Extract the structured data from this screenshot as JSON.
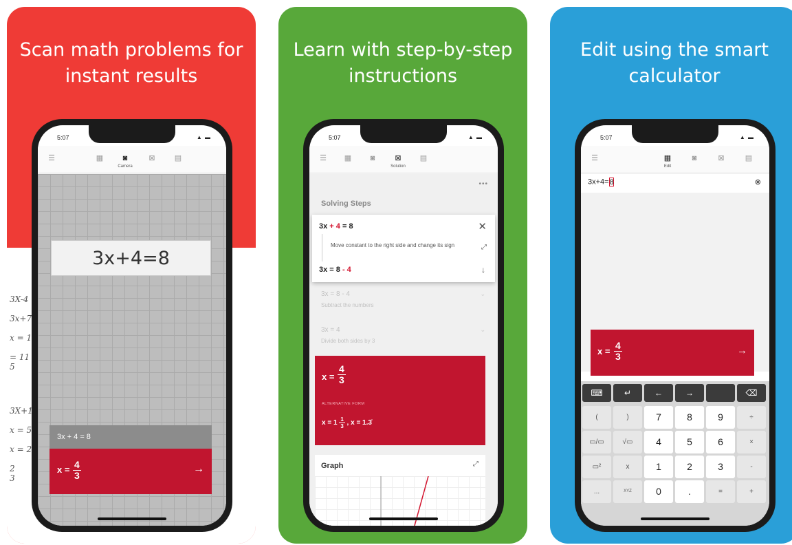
{
  "screens": [
    {
      "title": "Scan math problems for instant results",
      "time": "5:07",
      "status_icons": "▲ ▬",
      "toolbar": [
        "menu-icon",
        "calculator-icon",
        "camera-icon",
        "solution-icon",
        "notes-icon"
      ],
      "active_label": "Camera",
      "scanned_equation": "3x+4=8",
      "equation_bar": "3x + 4 = 8",
      "result": {
        "lhs": "x =",
        "num": "4",
        "den": "3"
      },
      "background_math": [
        "3X-4",
        "3x+7",
        "x = 11",
        "= 11",
        "5",
        "3X+1",
        "x = 5",
        "x = 2",
        "2",
        "3"
      ]
    },
    {
      "title": "Learn with step-by-step instructions",
      "time": "5:07",
      "status_icons": "▲ ▬",
      "active_label": "Solution",
      "more": "•••",
      "steps_heading": "Solving Steps",
      "active_step": {
        "eq_pre": "3x ",
        "eq_red": "+ 4",
        "eq_post": " = 8",
        "description": "Move constant to the right side and change its sign",
        "result_pre": "3x = 8 ",
        "result_red": "- 4"
      },
      "faded_steps": [
        {
          "eq": "3x = 8 - 4",
          "desc": "Subtract the numbers"
        },
        {
          "eq": "3x = 4",
          "desc": "Divide both sides by 3"
        }
      ],
      "result": {
        "lhs": "x =",
        "num": "4",
        "den": "3"
      },
      "alt_label": "ALTERNATIVE FORM",
      "alt_whole": "x = 1",
      "alt_num": "1",
      "alt_den": "3",
      "alt_decimal": ", x = 1.3̇",
      "graph_title": "Graph"
    },
    {
      "title": "Edit using the smart calculator",
      "time": "5:07",
      "status_icons": "▲ ▬",
      "active_label": "Edit",
      "input": "3x+4=",
      "input_cursor": "8",
      "clear": "⊗",
      "result": {
        "lhs": "x =",
        "num": "4",
        "den": "3"
      },
      "keyboard_top": [
        "⌨",
        "↵",
        "←",
        "→",
        "",
        "⌫"
      ],
      "keyboard_rows": [
        [
          "(",
          ")",
          "7",
          "8",
          "9",
          "÷"
        ],
        [
          "▭/▭",
          "√▭",
          "4",
          "5",
          "6",
          "×"
        ],
        [
          "▭²",
          "x",
          "1",
          "2",
          "3",
          "-"
        ],
        [
          "...",
          "XYZ",
          "0",
          ".",
          "=",
          "+"
        ]
      ]
    }
  ],
  "colors": {
    "red": "#ef3b36",
    "green": "#58a83a",
    "blue": "#2a9fd8",
    "result_red": "#c1152f"
  }
}
